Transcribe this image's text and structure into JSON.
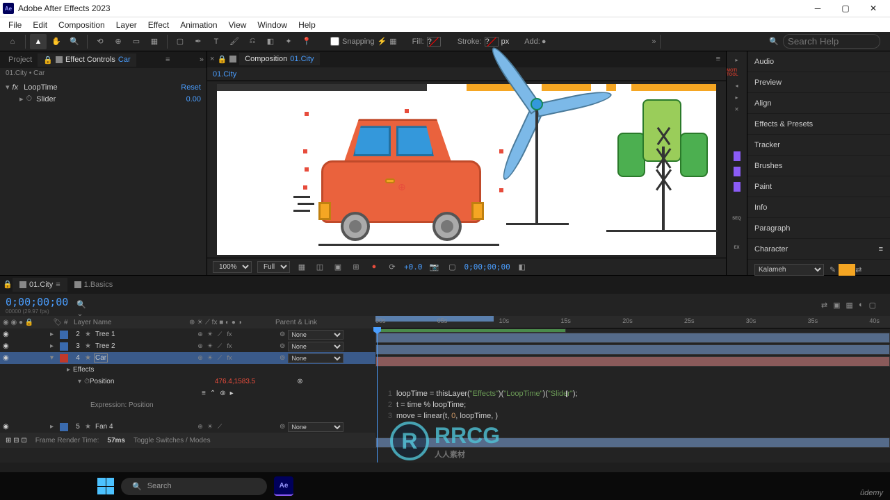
{
  "app": {
    "title": "Adobe After Effects 2023",
    "logo": "Ae"
  },
  "menu": [
    "File",
    "Edit",
    "Composition",
    "Layer",
    "Effect",
    "Animation",
    "View",
    "Window",
    "Help"
  ],
  "toolbar": {
    "snapping": "Snapping",
    "fill": "Fill:",
    "stroke": "Stroke:",
    "px": "px",
    "add": "Add:",
    "search_placeholder": "Search Help"
  },
  "left_panel": {
    "tabs": {
      "project": "Project",
      "effect_controls": "Effect Controls",
      "target": "Car"
    },
    "breadcrumb": "01.City • Car",
    "effect": {
      "name": "LoopTime",
      "reset": "Reset",
      "prop": "Slider",
      "value": "0.00"
    }
  },
  "comp_panel": {
    "tab": "Composition",
    "comp_name": "01.City",
    "subtab": "01.City",
    "zoom": "100%",
    "resolution": "Full",
    "exposure": "+0.0",
    "timecode": "0;00;00;00"
  },
  "right_panels": [
    "Audio",
    "Preview",
    "Align",
    "Effects & Presets",
    "Tracker",
    "Brushes",
    "Paint",
    "Info",
    "Paragraph",
    "Character"
  ],
  "right_narrow": {
    "motiontools": "MOTI\nTOOL",
    "seq": "SEQ",
    "ex": "EX"
  },
  "char_panel": {
    "font": "Kalameh",
    "color": "#f5a623"
  },
  "timeline": {
    "tabs": [
      "01.City",
      "1.Basics"
    ],
    "timecode": "0;00;00;00",
    "fps_hint": "00000 (29.97 fps)",
    "headers": {
      "num": "#",
      "layer_name": "Layer Name",
      "parent": "Parent & Link"
    },
    "layers": [
      {
        "num": 2,
        "name": "Tree 1",
        "color": "#3a6aad",
        "parent": "None"
      },
      {
        "num": 3,
        "name": "Tree 2",
        "color": "#3a6aad",
        "parent": "None"
      },
      {
        "num": 4,
        "name": "Car",
        "color": "#c0392b",
        "parent": "None",
        "selected": true
      },
      {
        "num": 5,
        "name": "Fan 4",
        "color": "#3a6aad",
        "parent": "None"
      }
    ],
    "effects_label": "Effects",
    "position": {
      "label": "Position",
      "value": "476.4,1583.5",
      "expr_label": "Expression: Position"
    },
    "switches": [
      "⊕",
      "☀",
      "⟋",
      "fx",
      "■",
      "◐",
      "●",
      "◑"
    ],
    "footer": {
      "frt_label": "Frame Render Time:",
      "frt_value": "57ms",
      "toggle": "Toggle Switches / Modes"
    },
    "ruler": [
      "00s",
      "05s",
      "10s",
      "15s",
      "20s",
      "25s",
      "30s",
      "35s",
      "40s"
    ]
  },
  "expression": {
    "lines": [
      {
        "n": 1,
        "plain": "loopTime = thisLayer(\"Effects\")(\"LoopTime\")(\"Slider\");"
      },
      {
        "n": 2,
        "plain": "t = time % loopTime;"
      },
      {
        "n": 3,
        "plain": "move = linear(t, 0, loopTime, )"
      }
    ]
  },
  "taskbar": {
    "search": "Search",
    "ae": "Ae"
  },
  "watermark": {
    "text": "RRCG",
    "sub": "人人素材"
  },
  "udemy": "ûdemy"
}
